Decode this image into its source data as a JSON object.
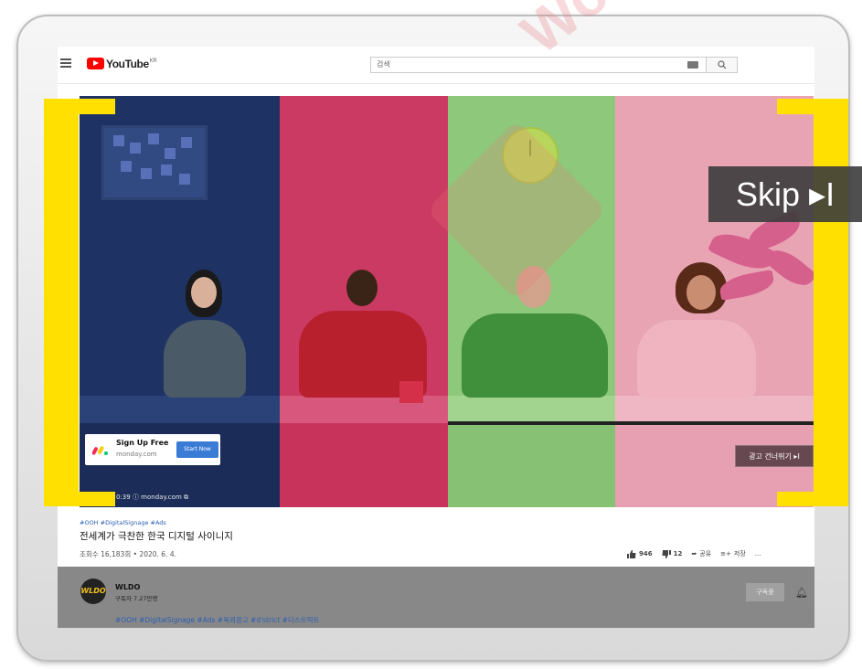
{
  "header": {
    "logo_text": "YouTube",
    "logo_region": "KR",
    "search_placeholder": "검색"
  },
  "ad": {
    "title": "Sign Up Free",
    "domain": "monday.com",
    "cta": "Start Now",
    "time_text": "0:39 ⓘ  monday.com ⧉",
    "skip_small": "광고 건너뛰기 ▸I",
    "skip_big": "Skip ▸I"
  },
  "video": {
    "hashtags": "#OOH #DigitalSignage #Ads",
    "title": "전세계가 극찬한 한국 디지털 사이니지",
    "views": "조회수 16,183회 • 2020. 6. 4.",
    "likes": "946",
    "dislikes": "12",
    "share_label": "공유",
    "save_label": "저장",
    "more_label": "..."
  },
  "channel": {
    "avatar_text": "WLDO",
    "name": "WLDO",
    "subs": "구독자 7.27만명",
    "subscribe_label": "구독중",
    "desc_tags": "#OOH #DigitalSignage #Ads #옥외광고 #d'strict #디스트릭트"
  },
  "watermark": {
    "text": "Wondershare PDFelement"
  },
  "colors": {
    "youtube_red": "#ff0000",
    "bracket_yellow": "#ffe000",
    "panel_blue": "#1e3364",
    "panel_red": "#cb3a62",
    "panel_green": "#8ec87a",
    "panel_pink": "#e9a4b4"
  }
}
